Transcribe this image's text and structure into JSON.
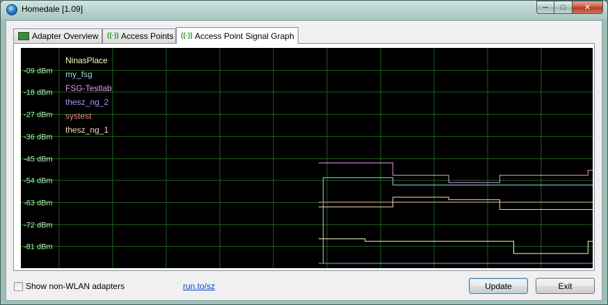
{
  "window": {
    "title": "Homedale [1.09]"
  },
  "tabs": [
    {
      "label": "Adapter Overview",
      "icon": "network-adapter-icon",
      "active": false
    },
    {
      "label": "Access Points",
      "icon": "wifi-antenna-icon",
      "active": false
    },
    {
      "label": "Access Point Signal Graph",
      "icon": "wifi-antenna-icon",
      "active": true
    }
  ],
  "graph": {
    "y_tick_labels": [
      "-09 dBm",
      "-18 dBm",
      "-27 dBm",
      "-36 dBm",
      "-45 dBm",
      "-54 dBm",
      "-63 dBm",
      "-72 dBm",
      "-81 dBm"
    ],
    "legend": [
      {
        "name": "NinasPlace",
        "color": "#ffffc0"
      },
      {
        "name": "my_fsg",
        "color": "#a6d8f0"
      },
      {
        "name": "FSG-Testlab",
        "color": "#e69be6"
      },
      {
        "name": "thesz_ng_2",
        "color": "#9a9af2"
      },
      {
        "name": "systest",
        "color": "#f08878"
      },
      {
        "name": "thesz_ng_1",
        "color": "#fcd8bc"
      }
    ],
    "colors": {
      "background": "#000000",
      "grid": "#1f5f1f",
      "axis_text": "#b4f4b4"
    }
  },
  "chart_data": {
    "type": "line",
    "title": "",
    "xlabel": "",
    "ylabel": "",
    "ylim": [
      -90,
      0
    ],
    "yticks": [
      -9,
      -18,
      -27,
      -36,
      -45,
      -54,
      -63,
      -72,
      -81
    ],
    "x": [
      0,
      1,
      2,
      3,
      4,
      5,
      6,
      7,
      8,
      9,
      10,
      11,
      12,
      13,
      14,
      15,
      16,
      17,
      18,
      19,
      20,
      21,
      22,
      23,
      24,
      25,
      26,
      27,
      28,
      29,
      30,
      31,
      32,
      33,
      34,
      35,
      36,
      37,
      38,
      39,
      40,
      41,
      42,
      43,
      44,
      45,
      46,
      47,
      48,
      49,
      50,
      51,
      52,
      53,
      54,
      55,
      56,
      57,
      58,
      59
    ],
    "series": [
      {
        "name": "NinasPlace",
        "color": "#ffffc0",
        "values": [
          -78,
          -78,
          -78,
          -78,
          -78,
          -78,
          -78,
          -78,
          -78,
          -78,
          -79,
          -79,
          -79,
          -79,
          -79,
          -79,
          -79,
          -79,
          -79,
          -79,
          -79,
          -79,
          -79,
          -79,
          -79,
          -79,
          -79,
          -79,
          -79,
          -79,
          -79,
          -79,
          -79,
          -79,
          -79,
          -79,
          -79,
          -79,
          -79,
          -79,
          -79,
          -79,
          -84,
          -84,
          -84,
          -84,
          -84,
          -84,
          -84,
          -84,
          -84,
          -84,
          -84,
          -84,
          -84,
          -84,
          -84,
          -84,
          -79,
          -79
        ]
      },
      {
        "name": "my_fsg",
        "color": "#a6d8f0",
        "values": [
          -88,
          -53,
          -53,
          -53,
          -53,
          -53,
          -53,
          -53,
          -53,
          -53,
          -53,
          -53,
          -53,
          -53,
          -53,
          -53,
          -56,
          -56,
          -56,
          -56,
          -56,
          -56,
          -56,
          -56,
          -56,
          -56,
          -56,
          -56,
          -56,
          -56,
          -56,
          -56,
          -56,
          -56,
          -56,
          -56,
          -56,
          -56,
          -56,
          -56,
          -56,
          -56,
          -56,
          -56,
          -56,
          -56,
          -56,
          -56,
          -56,
          -56,
          -56,
          -56,
          -56,
          -56,
          -56,
          -56,
          -56,
          -56,
          -56,
          -56
        ]
      },
      {
        "name": "FSG-Testlab",
        "color": "#e69be6",
        "values": [
          -47,
          -47,
          -47,
          -47,
          -47,
          -47,
          -47,
          -47,
          -47,
          -47,
          -47,
          -47,
          -47,
          -47,
          -47,
          -47,
          -52,
          -52,
          -52,
          -52,
          -52,
          -52,
          -52,
          -52,
          -52,
          -52,
          -52,
          -52,
          -55,
          -55,
          -55,
          -55,
          -55,
          -55,
          -55,
          -55,
          -55,
          -55,
          -55,
          -52,
          -52,
          -52,
          -52,
          -52,
          -52,
          -52,
          -52,
          -52,
          -52,
          -52,
          -52,
          -52,
          -52,
          -52,
          -52,
          -52,
          -52,
          -52,
          -50,
          -50
        ]
      },
      {
        "name": "thesz_ng_2",
        "color": "#9a9af2",
        "values": [
          -88,
          -88,
          -88,
          -88,
          -88,
          -88,
          -88,
          -88,
          -88,
          -88,
          -88,
          -88,
          -88,
          -88,
          -88,
          -88,
          -88,
          -88,
          -88,
          -88,
          -88,
          -88,
          -88,
          -88,
          -88,
          -88,
          -88,
          -88,
          -88,
          -88,
          -88,
          -88,
          -88,
          -88,
          -88,
          -88,
          -88,
          -88,
          -88,
          -88,
          -88,
          -88,
          -88,
          -88,
          -88,
          -88,
          -88,
          -88,
          -88,
          -88,
          -88,
          -88,
          -88,
          -88,
          -88,
          -88,
          -88,
          -88,
          -88,
          -88
        ]
      },
      {
        "name": "systest",
        "color": "#f08878",
        "values": [
          -63,
          -63,
          -63,
          -63,
          -63,
          -63,
          -63,
          -63,
          -63,
          -63,
          -63,
          -63,
          -63,
          -63,
          -63,
          -63,
          -63,
          -63,
          -63,
          -63,
          -63,
          -63,
          -63,
          -63,
          -63,
          -63,
          -63,
          -63,
          -63,
          -63,
          -63,
          -63,
          -63,
          -63,
          -63,
          -63,
          -63,
          -63,
          -63,
          -63,
          -63,
          -63,
          -63,
          -63,
          -63,
          -63,
          -63,
          -63,
          -63,
          -63,
          -63,
          -63,
          -63,
          -63,
          -63,
          -63,
          -63,
          -63,
          -63,
          -63
        ]
      },
      {
        "name": "thesz_ng_1",
        "color": "#fcd8bc",
        "values": [
          -65,
          -65,
          -65,
          -65,
          -65,
          -65,
          -65,
          -65,
          -65,
          -65,
          -65,
          -65,
          -65,
          -65,
          -65,
          -65,
          -61,
          -61,
          -61,
          -61,
          -61,
          -61,
          -61,
          -61,
          -61,
          -61,
          -61,
          -61,
          -62,
          -62,
          -62,
          -62,
          -62,
          -62,
          -62,
          -62,
          -62,
          -62,
          -62,
          -66,
          -66,
          -66,
          -66,
          -66,
          -66,
          -66,
          -66,
          -66,
          -66,
          -66,
          -66,
          -66,
          -66,
          -66,
          -66,
          -66,
          -66,
          -66,
          -66,
          -66
        ]
      }
    ]
  },
  "bottom": {
    "checkbox_label": "Show non-WLAN adapters",
    "checkbox_checked": false,
    "link_text": "run.to/sz",
    "update_label": "Update",
    "exit_label": "Exit"
  }
}
